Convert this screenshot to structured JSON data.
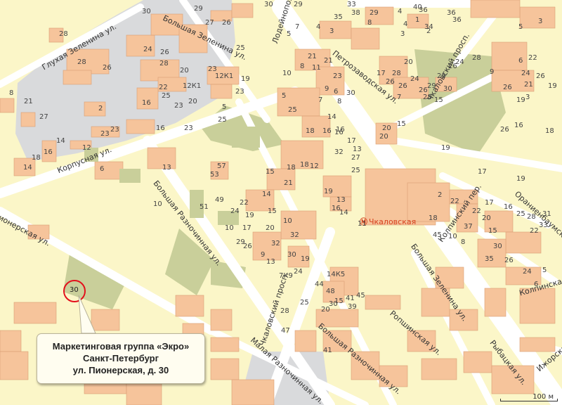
{
  "callout": {
    "line1": "Маркетинговая группа «Экро»",
    "line2": "Санкт-Петербург",
    "line3": "ул. Пионерская, д. 30"
  },
  "metro": {
    "name": "Чкаловская",
    "icon": "metro-icon"
  },
  "scale": {
    "label": "100 м"
  },
  "marker": {
    "house": "30"
  },
  "colors": {
    "background": "#fbf6c8",
    "building": "#f6c49b",
    "road": "#ffffff",
    "industrial": "#d9dadc",
    "green_block": "#c9cf9a",
    "marker": "#e3101c",
    "metro_text": "#d6421e"
  },
  "streets": [
    "Глухая Зеленина ул.",
    "Большая Зеленина ул.",
    "Лодейнопольская ул.",
    "Петрозаводская ул.",
    "Чкаловский просп.",
    "Корпусная ул.",
    "Большая Разночинная ул.",
    "Колпинский пер.",
    "Ораниенбаумская ул.",
    "Колпинская ул.",
    "Большая Зеленина ул.",
    "Ропшинская ул.",
    "Большая Разночинная ул.",
    "Малая Разночинная ул.",
    "Рыбацкая ул.",
    "Ижорская ул.",
    "Чкаловский просп.",
    "Пионерская ул."
  ],
  "house_numbers": [
    "30",
    "29",
    "27",
    "26",
    "25",
    "30",
    "29",
    "35",
    "33",
    "29",
    "8",
    "7",
    "5",
    "4",
    "3",
    "38",
    "40",
    "36",
    "36",
    "36",
    "34",
    "1",
    "4",
    "3",
    "2",
    "4",
    "5",
    "3",
    "6",
    "26",
    "3",
    "26",
    "28",
    "28",
    "26",
    "24",
    "26",
    "28",
    "20",
    "22",
    "25",
    "23",
    "20",
    "23",
    "12К1",
    "12К1",
    "23",
    "19",
    "21",
    "8",
    "10",
    "11",
    "21",
    "23",
    "9",
    "7",
    "5",
    "6",
    "8",
    "30",
    "28",
    "26",
    "24",
    "26",
    "28",
    "7",
    "20",
    "17",
    "26",
    "29",
    "30",
    "29",
    "15",
    "26",
    "24",
    "28",
    "9",
    "22",
    "24",
    "26",
    "19",
    "21",
    "19",
    "18",
    "16",
    "19",
    "17",
    "19",
    "22",
    "2",
    "18",
    "20",
    "20",
    "15",
    "25",
    "27",
    "25",
    "18",
    "16",
    "16",
    "16",
    "14",
    "32",
    "17",
    "13",
    "5",
    "25",
    "23",
    "16",
    "16",
    "23",
    "23",
    "12",
    "14",
    "16",
    "18",
    "14",
    "27",
    "21",
    "8",
    "2",
    "6",
    "10",
    "13",
    "57",
    "53",
    "51",
    "49",
    "24",
    "22",
    "19",
    "17",
    "15",
    "14",
    "15",
    "18",
    "18",
    "12",
    "21",
    "19",
    "16",
    "14",
    "13",
    "11",
    "10",
    "29",
    "26",
    "20",
    "32",
    "9",
    "13",
    "10",
    "32",
    "30",
    "19",
    "24",
    "7К9",
    "14К5",
    "44",
    "48",
    "15",
    "41",
    "39",
    "45",
    "30",
    "20",
    "25",
    "28",
    "47",
    "41",
    "45",
    "10",
    "8",
    "37",
    "22",
    "20",
    "17",
    "16",
    "25",
    "28",
    "22",
    "33",
    "31",
    "15",
    "30",
    "35",
    "26",
    "24",
    "6",
    "5"
  ]
}
